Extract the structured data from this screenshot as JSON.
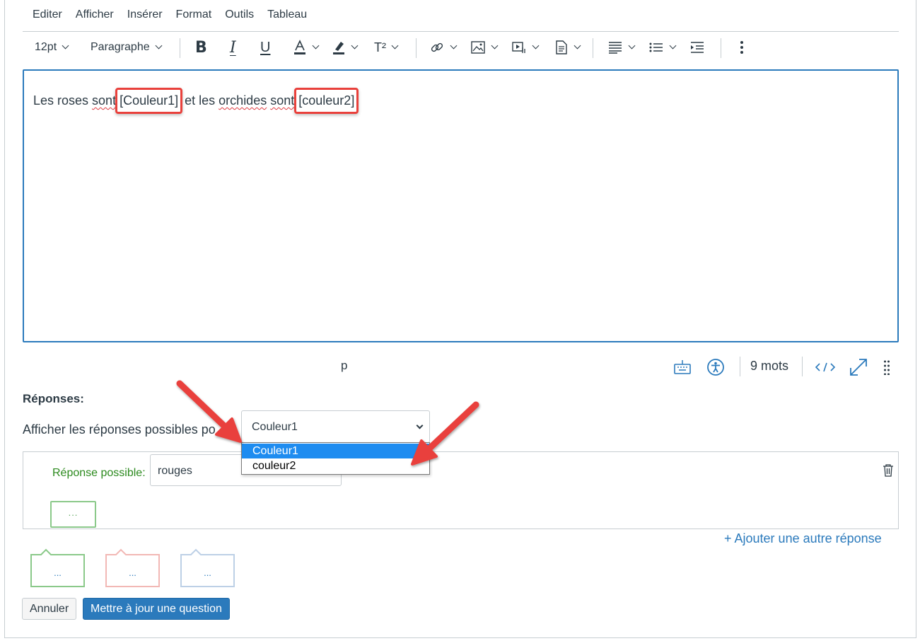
{
  "menu": [
    "Editer",
    "Afficher",
    "Insérer",
    "Format",
    "Outils",
    "Tableau"
  ],
  "toolbar": {
    "font_size": "12pt",
    "block_format": "Paragraphe",
    "superscript_label": "T²"
  },
  "editor": {
    "text_before": "Les roses ",
    "word_sont1": "sont",
    "blank1": "[Couleur1]",
    "text_middle": " et les ",
    "word_orchides": "orchides",
    "text_space": " ",
    "word_sont2": "sont",
    "blank2": "[couleur2]"
  },
  "status": {
    "path": "p",
    "word_count": "9 mots"
  },
  "answers": {
    "title": "Réponses:",
    "show_label": "Afficher les réponses possibles po",
    "selected_blank": "Couleur1",
    "dropdown_options": [
      "Couleur1",
      "couleur2"
    ],
    "answer_label": "Réponse possible:",
    "answer_value": "rouges",
    "mini_dots": "...",
    "add_answer": "+ Ajouter une autre réponse"
  },
  "feedback_dots": [
    "...",
    "...",
    "..."
  ],
  "buttons": {
    "cancel": "Annuler",
    "update": "Mettre à jour une question"
  },
  "colors": {
    "accent": "#2b7abc",
    "annotation_red": "#e9413c",
    "correct_green": "#2c8a1e",
    "dropdown_selected": "#1e8cf0"
  }
}
